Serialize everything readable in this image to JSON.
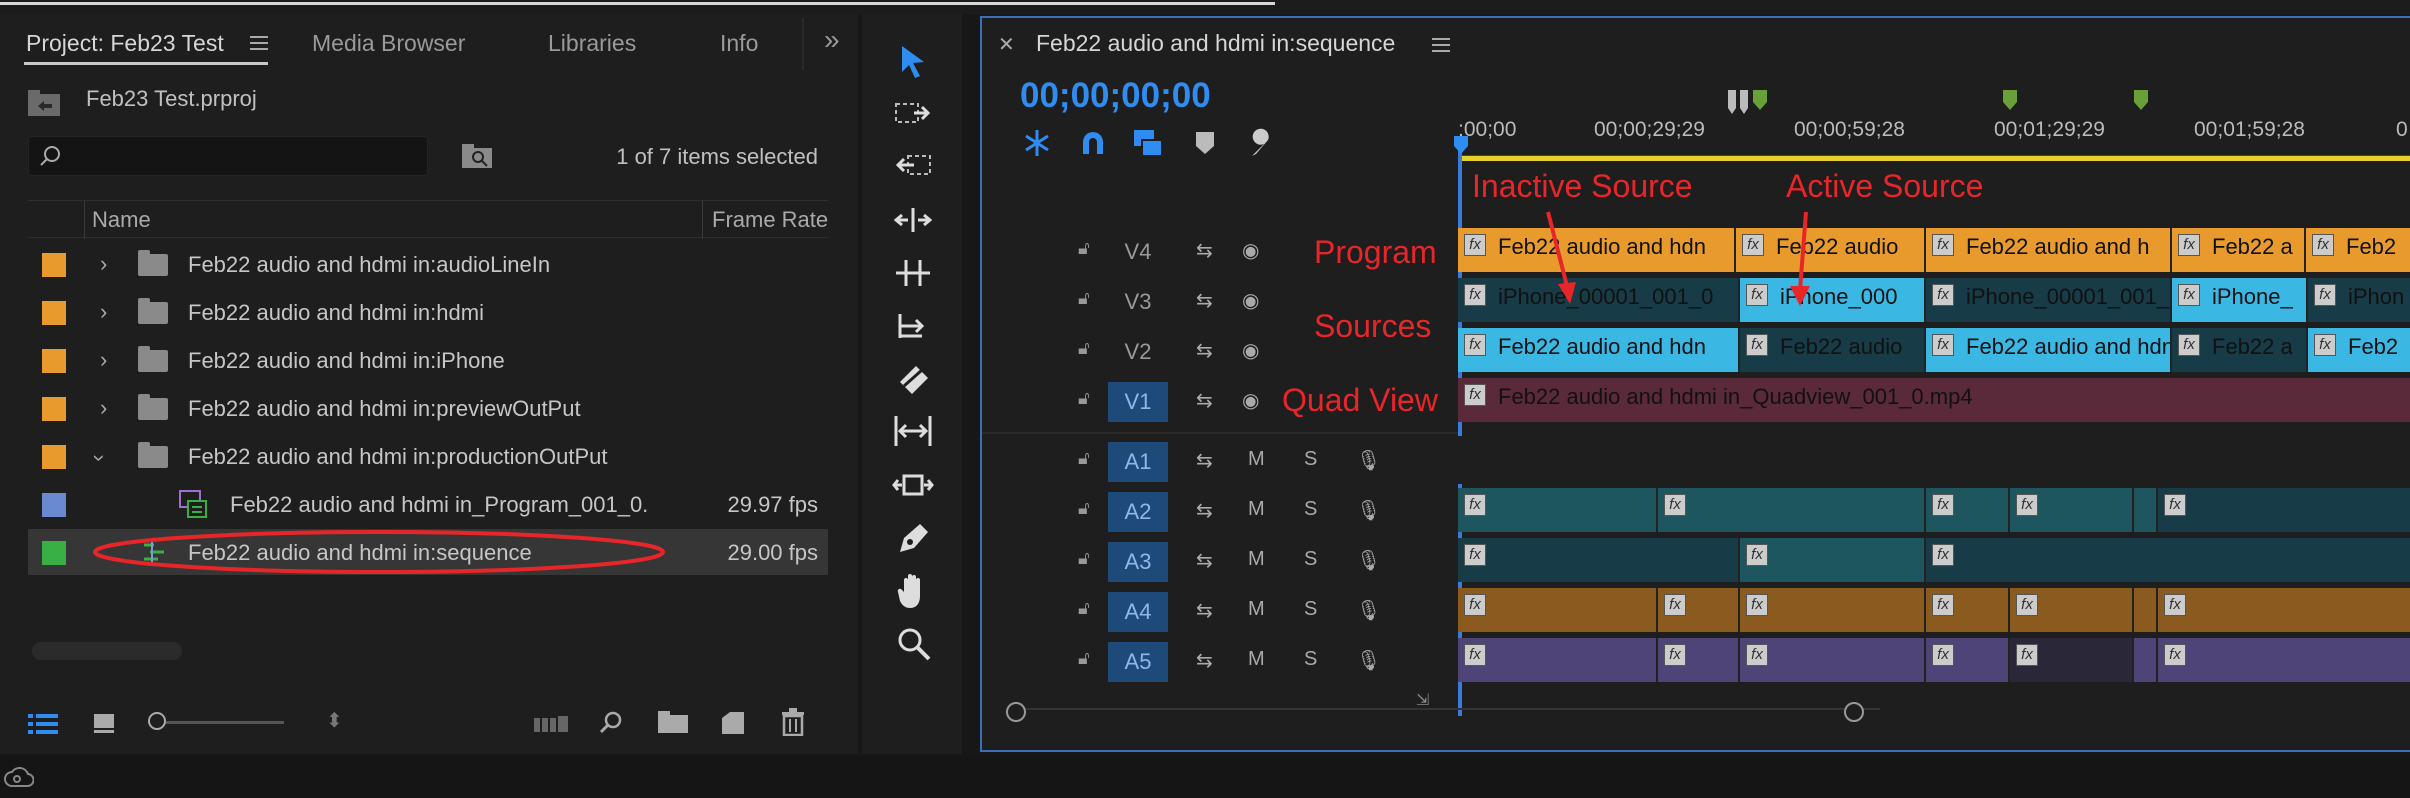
{
  "project_panel": {
    "tabs": [
      {
        "label": "Project: Feb23 Test"
      },
      {
        "label": "Media Browser"
      },
      {
        "label": "Libraries"
      },
      {
        "label": "Info"
      }
    ],
    "overflow": "»",
    "project_file": "Feb23 Test.prproj",
    "search_placeholder": "",
    "items_count": "1 of 7 items selected",
    "columns": {
      "name": "Name",
      "frame_rate": "Frame Rate"
    },
    "rows": [
      {
        "label": "Feb22 audio and hdmi in:audioLineIn",
        "fps": "",
        "color": "#e89a2c",
        "kind": "folder",
        "expanded": false
      },
      {
        "label": "Feb22 audio and hdmi in:hdmi",
        "fps": "",
        "color": "#e89a2c",
        "kind": "folder",
        "expanded": false
      },
      {
        "label": "Feb22 audio and hdmi in:iPhone",
        "fps": "",
        "color": "#e89a2c",
        "kind": "folder",
        "expanded": false
      },
      {
        "label": "Feb22 audio and hdmi in:previewOutPut",
        "fps": "",
        "color": "#e89a2c",
        "kind": "folder",
        "expanded": false
      },
      {
        "label": "Feb22 audio and hdmi in:productionOutPut",
        "fps": "",
        "color": "#e89a2c",
        "kind": "folder",
        "expanded": true
      },
      {
        "label": "Feb22 audio and hdmi in_Program_001_0.",
        "fps": "29.97 fps",
        "color": "#6a8ad0",
        "kind": "clip"
      },
      {
        "label": "Feb22 audio and hdmi in:sequence",
        "fps": "29.00 fps",
        "color": "#3aaf46",
        "kind": "sequence",
        "selected": true
      }
    ]
  },
  "timeline": {
    "title": "Feb22 audio and hdmi in:sequence",
    "timecode": "00;00;00;00",
    "ruler_ticks": [
      ";00;00",
      "00;00;29;29",
      "00;00;59;28",
      "00;01;29;29",
      "00;01;59;28"
    ],
    "video_tracks": [
      {
        "name": "V4",
        "on": false
      },
      {
        "name": "V3",
        "on": false
      },
      {
        "name": "V2",
        "on": false
      },
      {
        "name": "V1",
        "on": true
      }
    ],
    "audio_tracks": [
      {
        "name": "A1"
      },
      {
        "name": "A2"
      },
      {
        "name": "A3"
      },
      {
        "name": "A4"
      },
      {
        "name": "A5"
      }
    ],
    "audio_toggles": {
      "mute": "M",
      "solo": "S"
    },
    "clips": {
      "v4": [
        "Feb22 audio and hdn",
        "Feb22 audio",
        "Feb22 audio and h",
        "Feb22 a",
        "Feb2"
      ],
      "v3": [
        "iPhone_00001_001_0",
        "iPhone_000",
        "iPhone_00001_001_",
        "iPhone_",
        "iPhon"
      ],
      "v2": [
        "Feb22 audio and hdn",
        "Feb22 audio",
        "Feb22 audio and hdn",
        "Feb22 a",
        "Feb2"
      ],
      "v1": [
        "Feb22 audio and hdmi in_Quadview_001_0.mp4"
      ]
    },
    "annotations": {
      "inactive": "Inactive Source",
      "active": "Active Source",
      "program": "Program",
      "sources": "Sources",
      "quad": "Quad View"
    }
  },
  "colors": {
    "accent": "#2f8cf0",
    "annot": "#e8262a",
    "orange_clip": "#e89a2c",
    "cyan_clip": "#3ab7e3",
    "dark_clip": "#173b47",
    "v1_clip": "#5a2a3a",
    "audio_teal": "#1e5660",
    "audio_orange": "#8a5a1e",
    "audio_purple": "#4e4478"
  }
}
